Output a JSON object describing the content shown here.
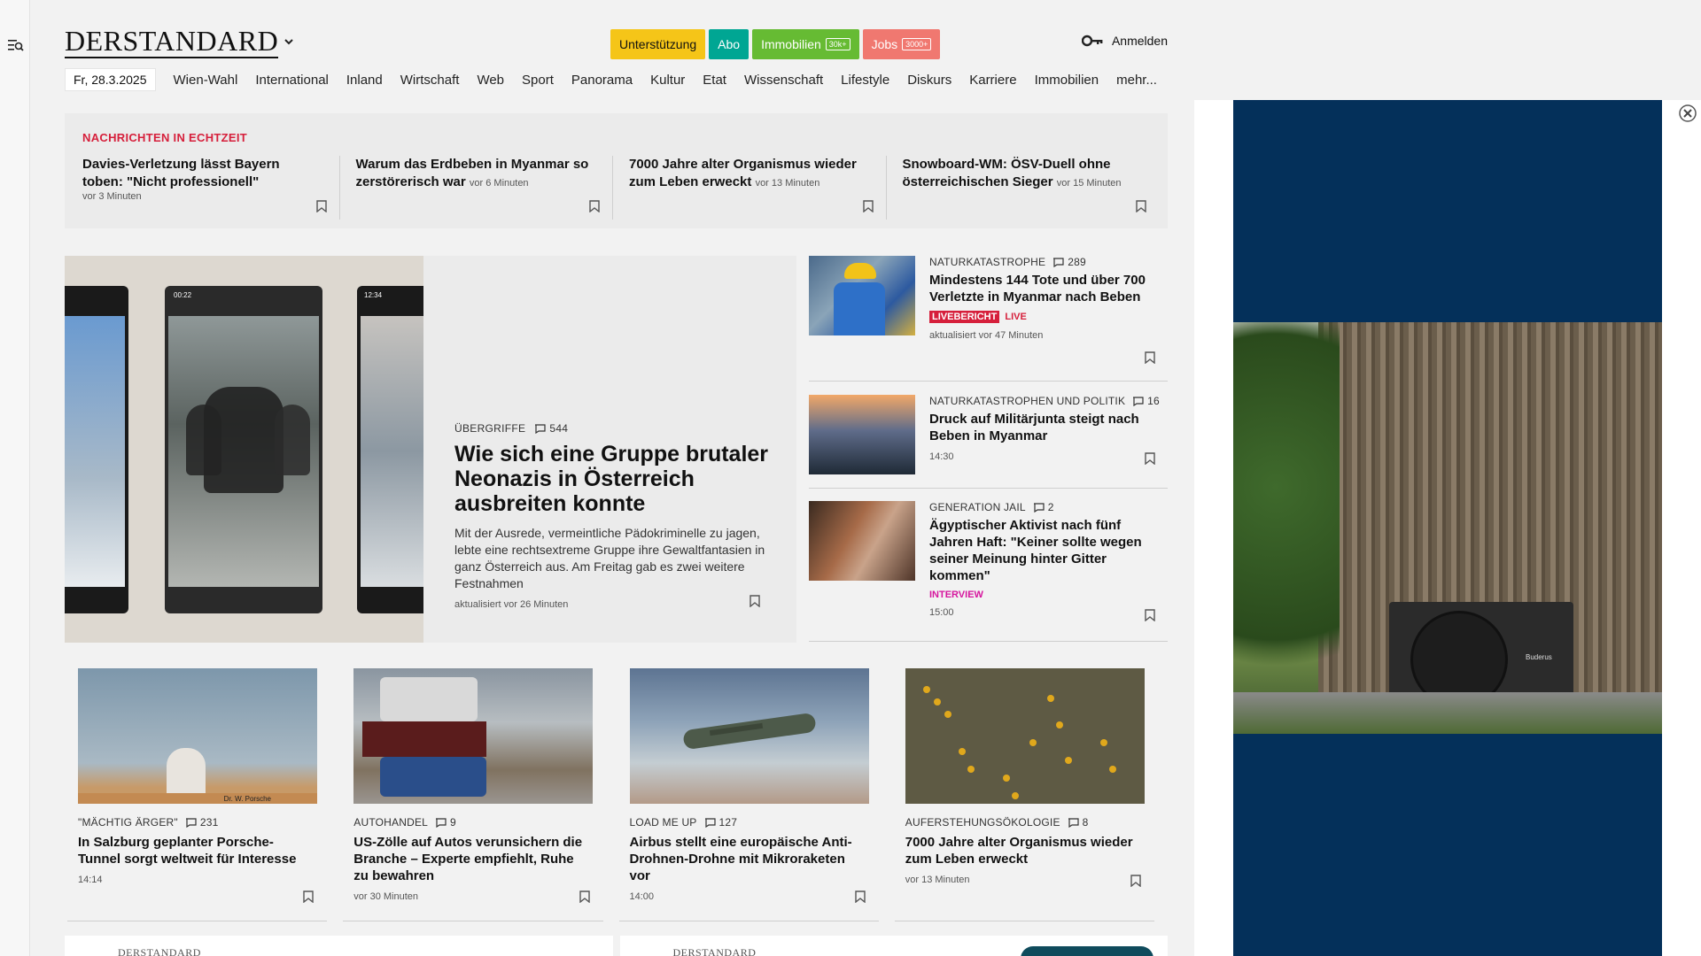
{
  "logo": "DERSTANDARD",
  "header": {
    "pills": [
      {
        "label": "Unterstützung",
        "bg": "#f5c518",
        "fg": "#111",
        "tag": ""
      },
      {
        "label": "Abo",
        "bg": "#00a693",
        "fg": "#fff",
        "tag": ""
      },
      {
        "label": "Immobilien",
        "bg": "#66bb33",
        "fg": "#fff",
        "tag": "30k+"
      },
      {
        "label": "Jobs",
        "bg": "#f07870",
        "fg": "#fff",
        "tag": "3000+"
      }
    ],
    "login_label": "Anmelden"
  },
  "nav": {
    "date": "Fr, 28.3.2025",
    "items": [
      "Wien-Wahl",
      "International",
      "Inland",
      "Wirtschaft",
      "Web",
      "Sport",
      "Panorama",
      "Kultur",
      "Etat",
      "Wissenschaft",
      "Lifestyle",
      "Diskurs",
      "Karriere",
      "Immobilien",
      "mehr..."
    ]
  },
  "ticker": {
    "title": "NACHRICHTEN IN ECHTZEIT",
    "items": [
      {
        "title": "Davies-Verletzung lässt Bayern toben: \"Nicht professionell\"",
        "time": "vor 3 Minuten"
      },
      {
        "title": "Warum das Erdbeben in Myanmar so zerstörerisch war",
        "time": "vor 6 Minuten"
      },
      {
        "title": "7000 Jahre alter Organismus wieder zum Leben erweckt",
        "time": "vor 13 Minuten"
      },
      {
        "title": "Snowboard-WM: ÖSV-Duell ohne österreichischen Sieger",
        "time": "vor 15 Minuten"
      }
    ]
  },
  "hero": {
    "kicker": "ÜBERGRIFFE",
    "comments": "544",
    "phone_time_1": "00:22",
    "phone_time_2": "12:34",
    "title": "Wie sich eine Gruppe brutaler Neonazis in Österreich ausbreiten konnte",
    "lead": "Mit der Ausrede, vermeintliche Pädokriminelle zu jagen, lebte eine rechtsextreme Gruppe ihre Gewaltfantasien in ganz Österreich aus. Am Freitag gab es zwei weitere Festnahmen",
    "meta": "aktualisiert vor 26 Minuten"
  },
  "side": [
    {
      "kicker": "NATURKATASTROPHE",
      "comments": "289",
      "title": "Mindestens 144 Tote und über 700 Verletzte in Myanmar nach Beben",
      "badge": "LIVEBERICHT",
      "live": "LIVE",
      "meta": "aktualisiert vor 47 Minuten"
    },
    {
      "kicker": "NATURKATASTROPHEN UND POLITIK",
      "comments": "16",
      "title": "Druck auf Militärjunta steigt nach Beben in Myanmar",
      "meta": "14:30"
    },
    {
      "kicker": "GENERATION JAIL",
      "comments": "2",
      "title": "Ägyptischer Aktivist nach fünf Jahren Haft: \"Keiner sollte wegen seiner Meinung hinter Gitter kommen\"",
      "tag": "INTERVIEW",
      "meta": "15:00"
    }
  ],
  "cards": [
    {
      "kicker": "\"MÄCHTIG ÄRGER\"",
      "comments": "231",
      "title": "In Salzburg geplanter Porsche-Tunnel sorgt weltweit für Interesse",
      "meta": "14:14",
      "sign": "Dr. W. Porsche"
    },
    {
      "kicker": "AUTOHANDEL",
      "comments": "9",
      "title": "US-Zölle auf Autos verunsichern die Branche – Experte empfiehlt, Ruhe zu bewahren",
      "meta": "vor 30 Minuten"
    },
    {
      "kicker": "LOAD ME UP",
      "comments": "127",
      "title": "Airbus stellt eine europäische Anti-Drohnen-Drohne mit Mikroraketen vor",
      "meta": "14:00"
    },
    {
      "kicker": "AUFERSTEHUNGSÖKOLOGIE",
      "comments": "8",
      "title": "7000 Jahre alter Organismus wieder zum Leben erweckt",
      "meta": "vor 13 Minuten"
    }
  ],
  "bottom_boxes": [
    "DERSTANDARD",
    "DERSTANDARD"
  ],
  "ad": {
    "brand": "Buderus"
  },
  "icons": {
    "menu": "search-menu-icon",
    "key": "key-icon",
    "bookmark": "bookmark-icon",
    "comment": "comment-icon",
    "close": "close-icon",
    "caret": "chevron-down-icon"
  }
}
